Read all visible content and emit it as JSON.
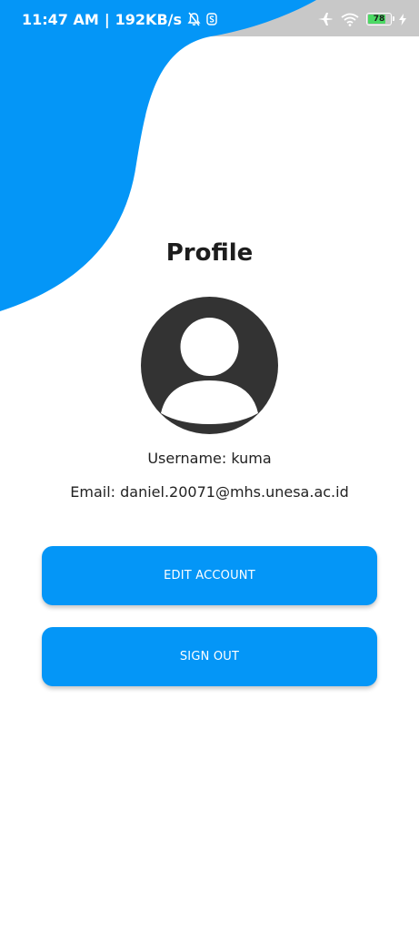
{
  "status_bar": {
    "time": "11:47 AM",
    "separator": "|",
    "network_speed": "192KB/s",
    "battery_level": "78",
    "battery_percent": 78,
    "icons": [
      "bell-off-icon",
      "s-notification-icon",
      "airplane-icon",
      "wifi-icon",
      "battery-icon",
      "charging-bolt-icon"
    ]
  },
  "profile": {
    "title": "Profile",
    "username_label": "Username: kuma",
    "email_label": "Email: daniel.20071@mhs.unesa.ac.id",
    "avatar_icon": "user-avatar-icon"
  },
  "actions": {
    "edit_account": "EDIT ACCOUNT",
    "sign_out": "SIGN OUT"
  },
  "colors": {
    "accent": "#0496f7",
    "status_bar_bg": "#c8c8c8",
    "avatar": "#333333",
    "battery_fill": "#4cd964"
  }
}
